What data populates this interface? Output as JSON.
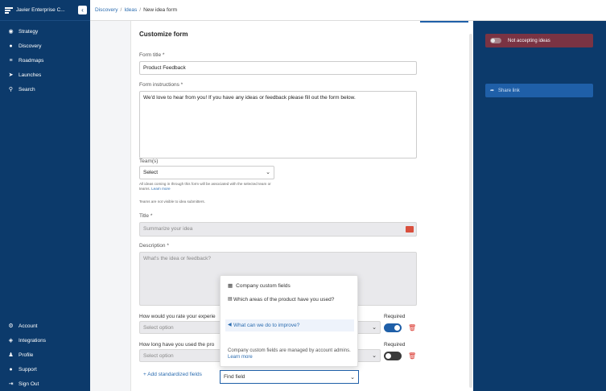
{
  "workspace": {
    "name": "Javier Enterprise C...",
    "collapse_icon": "chevron-left-icon"
  },
  "sidebar": {
    "items": [
      {
        "label": "Strategy",
        "icon": "strategy-icon"
      },
      {
        "label": "Discovery",
        "icon": "lightbulb-icon"
      },
      {
        "label": "Roadmaps",
        "icon": "roadmap-icon"
      },
      {
        "label": "Launches",
        "icon": "rocket-icon"
      },
      {
        "label": "Search",
        "icon": "search-icon"
      }
    ],
    "bottom_items": [
      {
        "label": "Account",
        "icon": "gear-icon"
      },
      {
        "label": "Integrations",
        "icon": "integrations-icon"
      },
      {
        "label": "Profile",
        "icon": "user-icon"
      },
      {
        "label": "Support",
        "icon": "help-icon"
      },
      {
        "label": "Sign Out",
        "icon": "sign-out-icon"
      }
    ]
  },
  "breadcrumb": {
    "items": [
      "Discovery",
      "Ideas",
      "New idea form"
    ],
    "separator": "/"
  },
  "form": {
    "heading": "Customize form",
    "title_label": "Form title *",
    "title_value": "Product Feedback",
    "instructions_label": "Form instructions *",
    "instructions_value": "We'd love to hear from you! If you have any ideas or feedback please fill out the form below.",
    "teams_label": "Team(s)",
    "teams_value": "Select",
    "teams_hint": "All ideas coming in through this form will be associated with the selected team or teams.",
    "teams_hint_link": "Learn more",
    "teams_note": "Teams are not visible to idea submitters.",
    "idea_title_label": "Title *",
    "idea_title_placeholder": "Summarize your idea",
    "description_label": "Description *",
    "description_placeholder": "What's the idea or feedback?",
    "q1_label": "How would you rate your experie",
    "q1_value": "Select option",
    "q2_label": "How long have you used the pro",
    "q2_value": "Select option",
    "required_label": "Required",
    "q1_required": true,
    "q2_required": false,
    "add_standardized": "+ Add standardized fields",
    "find_placeholder": "Find field"
  },
  "popup": {
    "heading": "Company custom fields",
    "items": [
      {
        "label": "Which areas of the product have you used?",
        "icon": "list-icon",
        "selected": false
      },
      {
        "label": "What can we do to improve?",
        "icon": "megaphone-icon",
        "selected": true
      }
    ],
    "note": "Company custom fields are managed by account admins.",
    "note_link": "Learn more"
  },
  "right_panel": {
    "accepting_label": "Not accepting ideas",
    "share_label": "Share link",
    "share_icon": "share-icon"
  },
  "colors": {
    "sidebar": "#0c3a6b",
    "accent": "#1f5fa8",
    "danger": "#d9342b",
    "accept_bg": "#7a3343"
  }
}
